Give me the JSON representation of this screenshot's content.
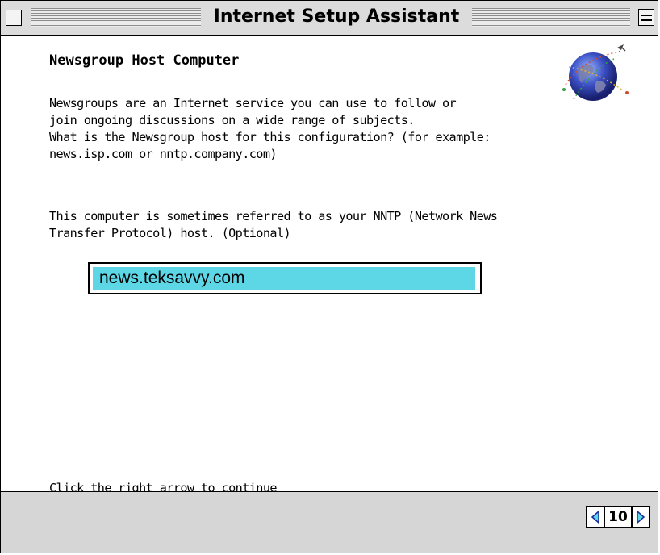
{
  "window": {
    "title": "Internet Setup Assistant"
  },
  "page": {
    "heading": "Newsgroup Host Computer",
    "paragraph1": [
      "Newsgroups are an Internet service you can use to follow or",
      "join ongoing discussions on a wide range of subjects."
    ],
    "paragraph2": [
      "What is the Newsgroup host for this configuration? (for example:",
      "news.isp.com or nntp.company.com)"
    ],
    "paragraph3": [
      "This computer is sometimes referred to as your NNTP (Network News",
      "Transfer Protocol) host. (Optional)"
    ],
    "host_field": {
      "value": "news.teksavvy.com"
    },
    "continue_hint": "Click the right arrow to continue"
  },
  "footer": {
    "page_number": "10"
  },
  "colors": {
    "selection_highlight": "#5dd6e6",
    "title_bar": "#dcdcdc",
    "footer_bar": "#d6d6d6"
  },
  "icons": {
    "close": "close-box-icon",
    "zoom": "zoom-box-icon",
    "globe": "globe-icon",
    "back": "left-arrow-icon",
    "forward": "right-arrow-icon"
  }
}
